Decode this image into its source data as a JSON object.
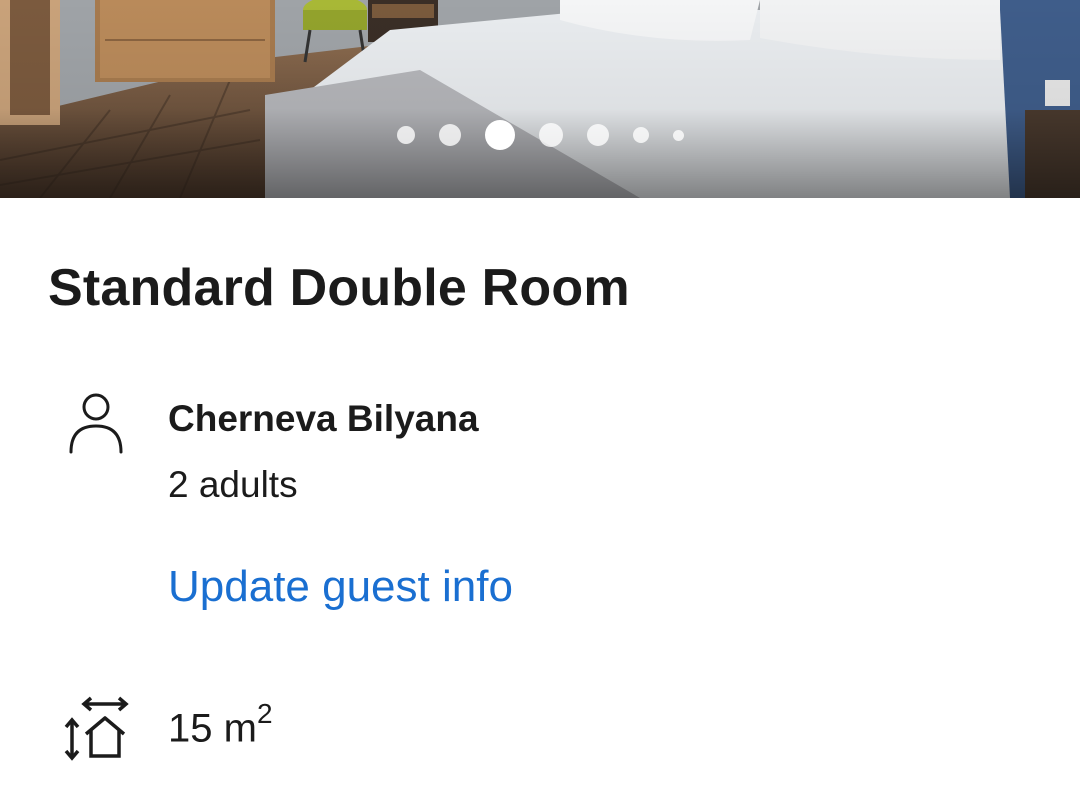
{
  "gallery": {
    "image_description_icon": "room-photo",
    "dots_count": 7,
    "active_dot_index": 3
  },
  "room": {
    "title": "Standard Double Room",
    "guest_name": "Cherneva Bilyana",
    "guest_count": "2 adults",
    "update_guest_link": "Update guest info",
    "size_value": "15 m",
    "size_unit_superscript": "2"
  },
  "colors": {
    "link": "#1a6fd1",
    "text": "#1b1b1b"
  },
  "icons": {
    "guest": "person-icon",
    "size": "room-size-icon"
  }
}
